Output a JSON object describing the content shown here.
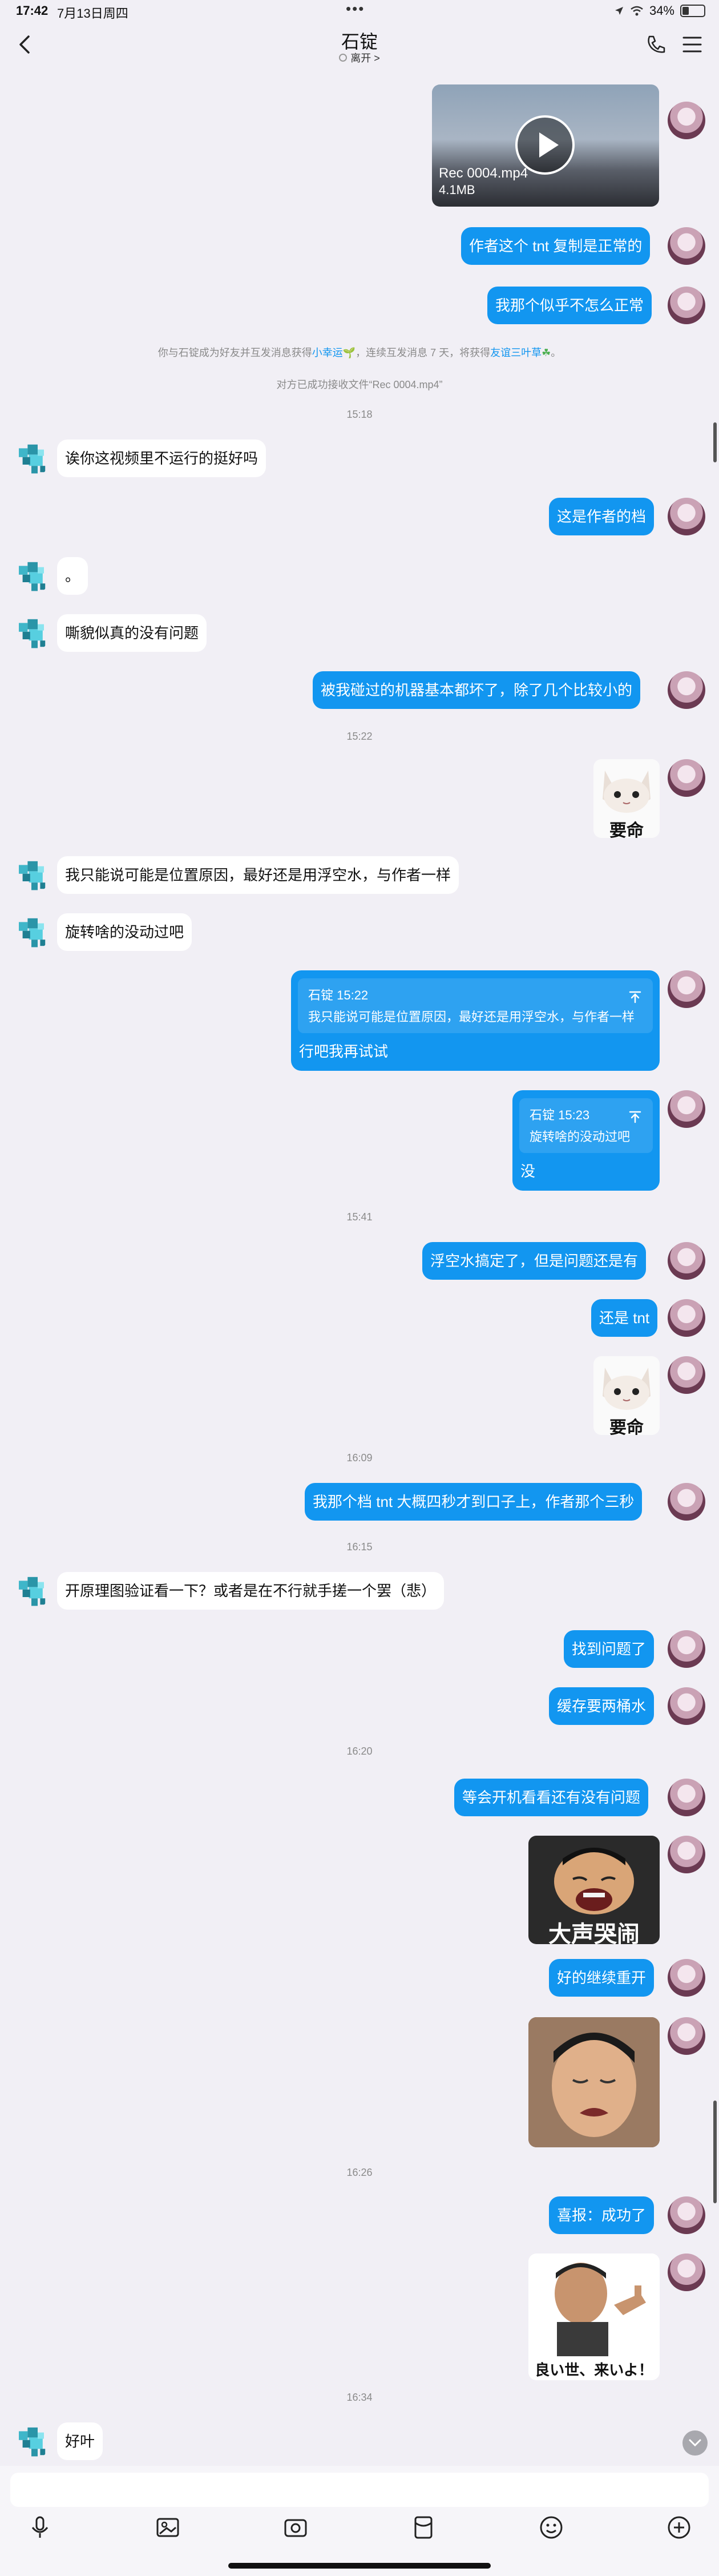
{
  "status_bar": {
    "time": "17:42",
    "date": "7月13日周四",
    "battery": "34%",
    "battery_level": 0.34
  },
  "header": {
    "title": "石锭",
    "status": "离开 >"
  },
  "video": {
    "filename": "Rec 0004.mp4",
    "size": "4.1MB"
  },
  "messages": {
    "m1": "作者这个 tnt 复制是正常的",
    "m2": "我那个似乎不怎么正常",
    "m3": "诶你这视频里不运行的挺好吗",
    "m4": "这是作者的档",
    "m5": "。",
    "m6": "嘶貌似真的没有问题",
    "m7": "被我碰过的机器基本都坏了，除了几个比较小的",
    "m8": "我只能说可能是位置原因，最好还是用浮空水，与作者一样",
    "m9": "旋转啥的没动过吧",
    "m10": "浮空水搞定了，但是问题还是有",
    "m11": "还是 tnt",
    "m12": "我那个档 tnt 大概四秒才到口子上，作者那个三秒",
    "m13": "开原理图验证看一下？或者是在不行就手搓一个罢（悲）",
    "m14": "找到问题了",
    "m15": "缓存要两桶水",
    "m16": "等会开机看看还有没有问题",
    "m17": "好的继续重开",
    "m18": "喜报：成功了",
    "m19": "好叶"
  },
  "quotes": {
    "q1": {
      "name": "石锭 15:22",
      "text": "我只能说可能是位置原因，最好还是用浮空水，与作者一样",
      "reply": "行吧我再试试"
    },
    "q2": {
      "name": "石锭 15:23",
      "text": "旋转啥的没动过吧",
      "reply": "没"
    }
  },
  "system": {
    "friendship_pre": "你与石锭成为好友并互发消息获得",
    "friendship_tag1": "小幸运",
    "friendship_mid": "，连续互发消息 7 天，将获得",
    "friendship_tag2": "友谊三叶草",
    "file_received": "对方已成功接收文件“Rec 0004.mp4”"
  },
  "timestamps": {
    "t1": "15:18",
    "t2": "15:22",
    "t3": "15:41",
    "t4": "16:09",
    "t5": "16:15",
    "t6": "16:20",
    "t7": "16:26",
    "t8": "16:34"
  },
  "stickers": {
    "cat1": "要命",
    "cat2": "要命",
    "crying": "大声哭闹",
    "thumbs": "良い世、来いよ！"
  },
  "colors": {
    "accent": "#1296f0",
    "background": "#f1eff5"
  }
}
